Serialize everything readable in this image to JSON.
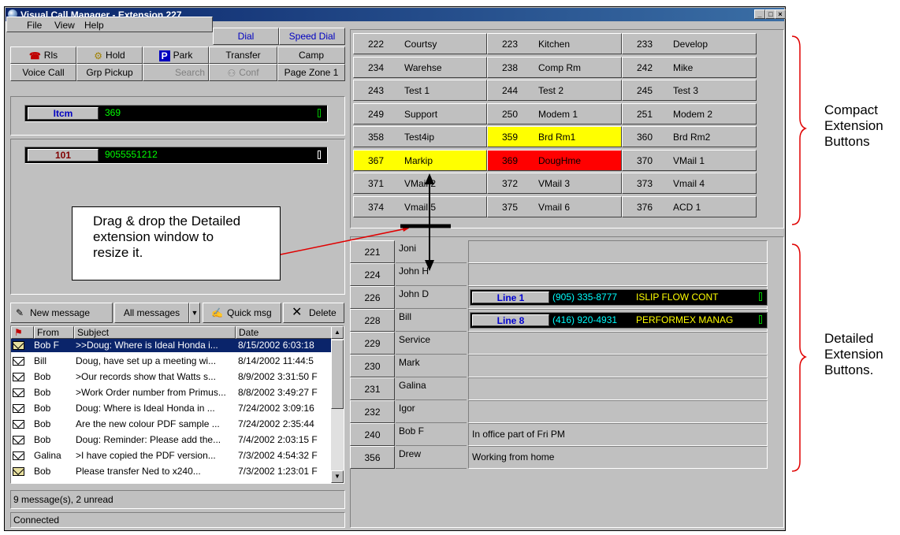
{
  "window": {
    "title": "Visual Call Manager - Extension 227",
    "controls": [
      "_",
      "□",
      "×"
    ]
  },
  "menu": {
    "items": [
      "File",
      "View",
      "Help"
    ]
  },
  "toolbar": {
    "dial": "Dial",
    "speed_dial": "Speed Dial",
    "rls": "Rls",
    "hold": "Hold",
    "park": "Park",
    "transfer": "Transfer",
    "camp": "Camp",
    "voice_call": "Voice Call",
    "grp_pickup": "Grp Pickup",
    "search": "Search",
    "conf": "Conf",
    "page_zone": "Page Zone 1"
  },
  "lines": [
    {
      "label": "Itcm",
      "number": "369",
      "indicator": "0"
    },
    {
      "label": "101",
      "number": "9055551212",
      "indicator": "0"
    }
  ],
  "messages_toolbar": {
    "new_message": "New message",
    "all_messages": "All messages",
    "quick_msg": "Quick msg",
    "delete": "Delete"
  },
  "messages": {
    "headers": [
      "From",
      "Subject",
      "Date"
    ],
    "rows": [
      {
        "from": "Bob F",
        "subject": ">>Doug: Where is Ideal Honda i...",
        "date": "8/15/2002 6:03:18",
        "unread": true,
        "selected": true
      },
      {
        "from": "Bill",
        "subject": "Doug, have set up a meeting wi...",
        "date": "8/14/2002 11:44:5",
        "unread": false
      },
      {
        "from": "Bob",
        "subject": ">Our records show that Watts s...",
        "date": "8/9/2002 3:31:50 F",
        "unread": false
      },
      {
        "from": "Bob",
        "subject": ">Work Order number from Primus...",
        "date": "8/8/2002 3:49:27 F",
        "unread": false
      },
      {
        "from": "Bob",
        "subject": "Doug: Where is Ideal Honda in ...",
        "date": "7/24/2002 3:09:16",
        "unread": false
      },
      {
        "from": "Bob",
        "subject": "Are the new colour PDF sample ...",
        "date": "7/24/2002 2:35:44",
        "unread": false
      },
      {
        "from": "Bob",
        "subject": "Doug: Reminder: Please add the...",
        "date": "7/4/2002 2:03:15 F",
        "unread": false
      },
      {
        "from": "Galina",
        "subject": ">I have copied the PDF version...",
        "date": "7/3/2002 4:54:32 F",
        "unread": false
      },
      {
        "from": "Bob",
        "subject": "Please transfer Ned to x240...",
        "date": "7/3/2002 1:23:01 F",
        "unread": true
      }
    ]
  },
  "status": {
    "messages": "9 message(s), 2 unread",
    "connection": "Connected"
  },
  "compact_extensions": [
    [
      {
        "n": "222",
        "l": "Courtsy"
      },
      {
        "n": "223",
        "l": "Kitchen"
      },
      {
        "n": "233",
        "l": "Develop"
      }
    ],
    [
      {
        "n": "234",
        "l": "Warehse"
      },
      {
        "n": "238",
        "l": "Comp Rm"
      },
      {
        "n": "242",
        "l": "Mike"
      }
    ],
    [
      {
        "n": "243",
        "l": "Test 1"
      },
      {
        "n": "244",
        "l": "Test 2"
      },
      {
        "n": "245",
        "l": "Test 3"
      }
    ],
    [
      {
        "n": "249",
        "l": "Support"
      },
      {
        "n": "250",
        "l": "Modem 1"
      },
      {
        "n": "251",
        "l": "Modem 2"
      }
    ],
    [
      {
        "n": "358",
        "l": "Test4ip"
      },
      {
        "n": "359",
        "l": "Brd Rm1",
        "state": "yellow"
      },
      {
        "n": "360",
        "l": "Brd Rm2"
      }
    ],
    [
      {
        "n": "367",
        "l": "Markip",
        "state": "yellow"
      },
      {
        "n": "369",
        "l": "DougHme",
        "state": "red"
      },
      {
        "n": "370",
        "l": "VMail 1"
      }
    ],
    [
      {
        "n": "371",
        "l": "VMail 2"
      },
      {
        "n": "372",
        "l": "VMail 3"
      },
      {
        "n": "373",
        "l": "Vmail 4"
      }
    ],
    [
      {
        "n": "374",
        "l": "Vmail 5"
      },
      {
        "n": "375",
        "l": "Vmail 6"
      },
      {
        "n": "376",
        "l": "ACD 1"
      }
    ]
  ],
  "detailed_extensions": [
    {
      "n": "221",
      "name": "Joni",
      "info": ""
    },
    {
      "n": "224",
      "name": "John H",
      "info": ""
    },
    {
      "n": "226",
      "name": "John D",
      "info": "",
      "line": {
        "label": "Line 1",
        "number": "(905) 335-8777",
        "caller": "ISLIP FLOW CONT",
        "indicator": "0"
      }
    },
    {
      "n": "228",
      "name": "Bill",
      "info": "",
      "line": {
        "label": "Line 8",
        "number": "(416) 920-4931",
        "caller": "PERFORMEX MANAG",
        "indicator": "0"
      }
    },
    {
      "n": "229",
      "name": "Service",
      "info": ""
    },
    {
      "n": "230",
      "name": "Mark",
      "info": ""
    },
    {
      "n": "231",
      "name": "Galina",
      "info": ""
    },
    {
      "n": "232",
      "name": "Igor",
      "info": ""
    },
    {
      "n": "240",
      "name": "Bob F",
      "info": "In office part of Fri PM"
    },
    {
      "n": "356",
      "name": "Drew",
      "info": "Working from home"
    }
  ],
  "annotations": {
    "drag_note": "Drag & drop the Detailed extension window to resize it.",
    "compact_label": "Compact Extension Buttons",
    "detailed_label": "Detailed Extension Buttons."
  },
  "colors": {
    "yellow": "#ffff00",
    "red": "#ff0000",
    "title": "#0a246a",
    "annot": "#e00000"
  }
}
